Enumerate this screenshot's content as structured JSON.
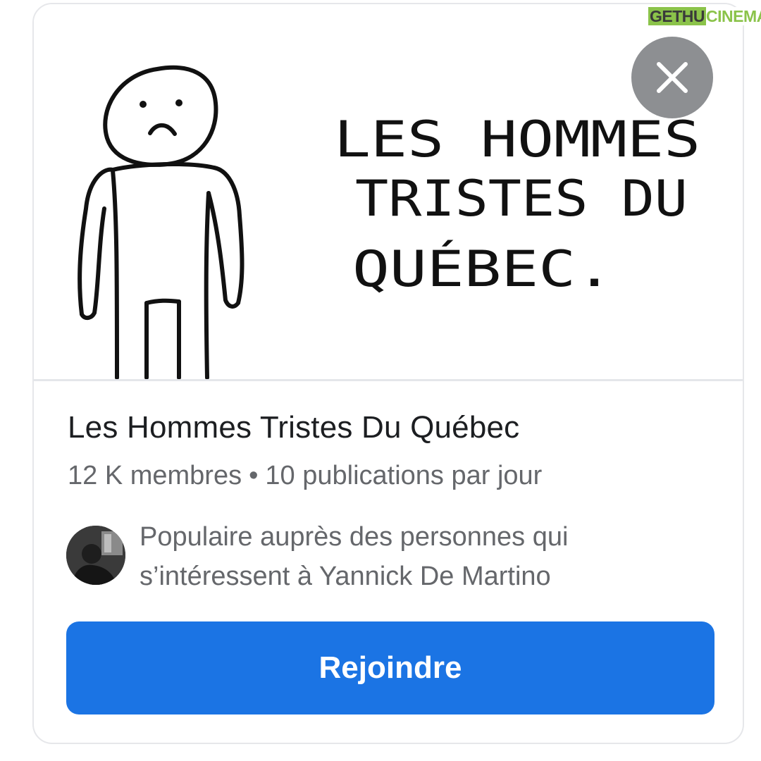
{
  "watermark": {
    "part1": "GETHU",
    "part2": "CINEMA"
  },
  "cover": {
    "handwritten_lines": [
      "LES HOMMES",
      "TRISTES DU",
      "QUÉBEC."
    ],
    "close_icon": "close-icon"
  },
  "group": {
    "name": "Les Hommes Tristes Du Québec",
    "members": "12 K membres",
    "separator": "•",
    "activity": "10 publications par jour"
  },
  "suggestion": {
    "reason_line1": "Populaire auprès des personnes qui",
    "reason_line2": "s’intéressent à Yannick De Martino",
    "avatar_icon": "avatar"
  },
  "actions": {
    "join_label": "Rejoindre"
  },
  "colors": {
    "primary_button": "#1b74e4",
    "secondary_text": "#65676b",
    "title_text": "#1c1e21",
    "close_button_bg": "#8d8f92"
  }
}
